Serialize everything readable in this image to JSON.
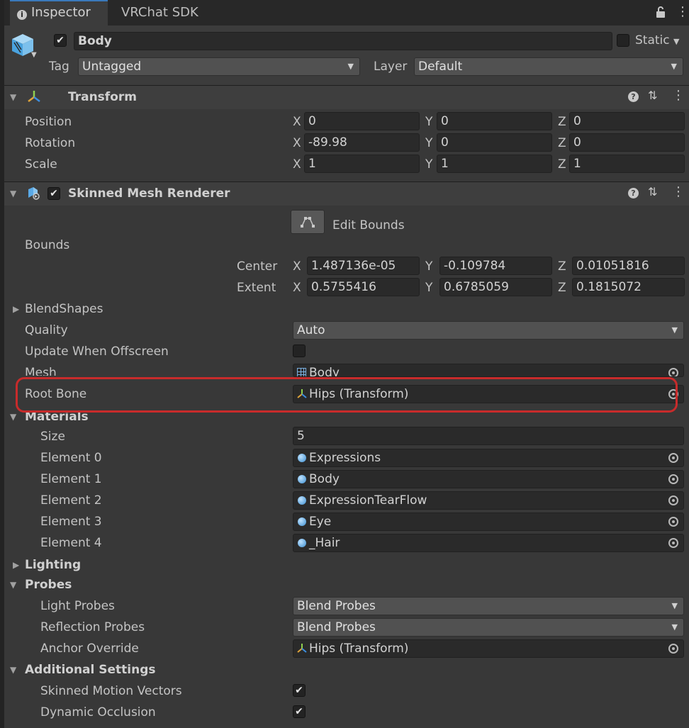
{
  "tabs": [
    {
      "label": "Inspector",
      "icon": "info-icon"
    },
    {
      "label": "VRChat SDK"
    }
  ],
  "object": {
    "name": "Body",
    "active": true,
    "static_label": "Static",
    "static_checked": false,
    "tag_label": "Tag",
    "tag_value": "Untagged",
    "layer_label": "Layer",
    "layer_value": "Default"
  },
  "transform": {
    "title": "Transform",
    "rows": [
      {
        "label": "Position",
        "x": "0",
        "y": "0",
        "z": "0"
      },
      {
        "label": "Rotation",
        "x": "-89.98",
        "y": "0",
        "z": "0"
      },
      {
        "label": "Scale",
        "x": "1",
        "y": "1",
        "z": "1"
      }
    ]
  },
  "axes": {
    "x": "X",
    "y": "Y",
    "z": "Z"
  },
  "smr": {
    "title": "Skinned Mesh Renderer",
    "enabled": true,
    "edit_bounds_label": "Edit Bounds",
    "bounds_label": "Bounds",
    "center_label": "Center",
    "center": {
      "x": "1.487136e-05",
      "y": "-0.109784",
      "z": "0.01051816"
    },
    "extent_label": "Extent",
    "extent": {
      "x": "0.5755416",
      "y": "0.6785059",
      "z": "0.1815072"
    },
    "blendshapes_label": "BlendShapes",
    "quality_label": "Quality",
    "quality_value": "Auto",
    "update_offscreen_label": "Update When Offscreen",
    "update_offscreen_checked": false,
    "mesh_label": "Mesh",
    "mesh_value": "Body",
    "root_bone_label": "Root Bone",
    "root_bone_value": "Hips (Transform)",
    "materials_label": "Materials",
    "size_label": "Size",
    "size_value": "5",
    "elements": [
      {
        "label": "Element 0",
        "value": "Expressions"
      },
      {
        "label": "Element 1",
        "value": "Body"
      },
      {
        "label": "Element 2",
        "value": "ExpressionTearFlow"
      },
      {
        "label": "Element 3",
        "value": "Eye"
      },
      {
        "label": "Element 4",
        "value": "_Hair"
      }
    ],
    "lighting_label": "Lighting",
    "probes_label": "Probes",
    "light_probes_label": "Light Probes",
    "light_probes_value": "Blend Probes",
    "reflection_probes_label": "Reflection Probes",
    "reflection_probes_value": "Blend Probes",
    "anchor_override_label": "Anchor Override",
    "anchor_override_value": "Hips (Transform)",
    "additional_label": "Additional Settings",
    "skinned_motion_label": "Skinned Motion Vectors",
    "skinned_motion_checked": true,
    "dynamic_occlusion_label": "Dynamic Occlusion",
    "dynamic_occlusion_checked": true
  },
  "colors": {
    "background": "#383838",
    "accent_tab": "#3a79bb",
    "highlight_box": "#c82b2b"
  }
}
